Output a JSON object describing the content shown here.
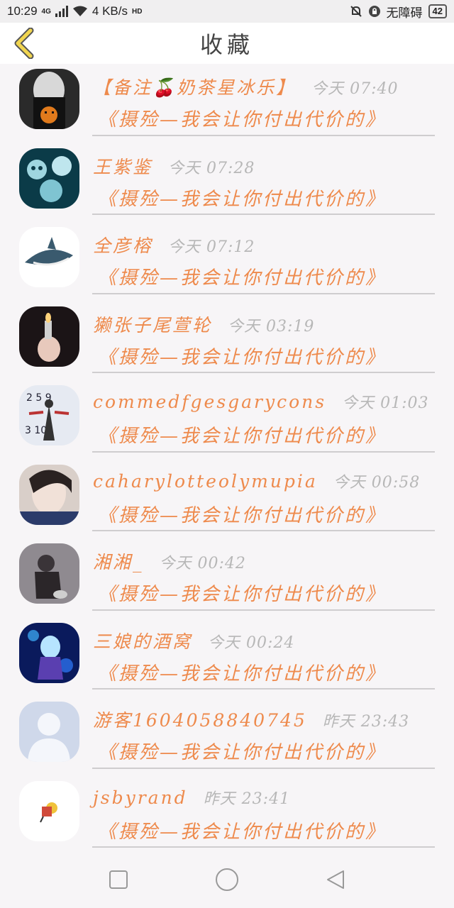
{
  "status_bar": {
    "time": "10:29",
    "network": "4G",
    "speed": "4 KB/s",
    "hd": "HD",
    "accessibility": "无障碍",
    "battery": "42"
  },
  "header": {
    "title": "收藏",
    "back_icon": "chevron-left-icon",
    "accent_color": "#f1d54f"
  },
  "colors": {
    "name": "#ee8a4c",
    "time": "#b7b7b7",
    "message": "#ee8a4c"
  },
  "favorites": [
    {
      "name": "【备注🍒奶茶星冰乐】",
      "time": "今天 07:40",
      "message": "《摄殓—我会让你付出代价的》",
      "avatar": "dark-pumpkin-girl"
    },
    {
      "name": "王紫鉴",
      "time": "今天 07:28",
      "message": "《摄殓—我会让你付出代价的》",
      "avatar": "skull-ghosts"
    },
    {
      "name": "全彦榕",
      "time": "今天 07:12",
      "message": "《摄殓—我会让你付出代价的》",
      "avatar": "shark"
    },
    {
      "name": "獭张子尾萱轮",
      "time": "今天 03:19",
      "message": "《摄殓—我会让你付出代价的》",
      "avatar": "lighter-hand"
    },
    {
      "name": "commedfgesgarycons",
      "time": "今天 01:03",
      "message": "《摄殓—我会让你付出代价的》",
      "avatar": "clock-figure"
    },
    {
      "name": "caharylotteolymupia",
      "time": "今天 00:58",
      "message": "《摄殓—我会让你付出代价的》",
      "avatar": "girl-face"
    },
    {
      "name": "湘湘_",
      "time": "今天 00:42",
      "message": "《摄殓—我会让你付出代价的》",
      "avatar": "sitting-person"
    },
    {
      "name": "三娘的酒窝",
      "time": "今天 00:24",
      "message": "《摄殓—我会让你付出代价的》",
      "avatar": "anime-blue"
    },
    {
      "name": "游客1604058840745",
      "time": "昨天 23:43",
      "message": "《摄殓—我会让你付出代价的》",
      "avatar": "default-person"
    },
    {
      "name": "jsbyrand",
      "time": "昨天 23:41",
      "message": "《摄殓—我会让你付出代价的》",
      "avatar": "small-sticker"
    }
  ],
  "navbar": {
    "icons": [
      "square-icon",
      "circle-icon",
      "triangle-back-icon"
    ]
  }
}
